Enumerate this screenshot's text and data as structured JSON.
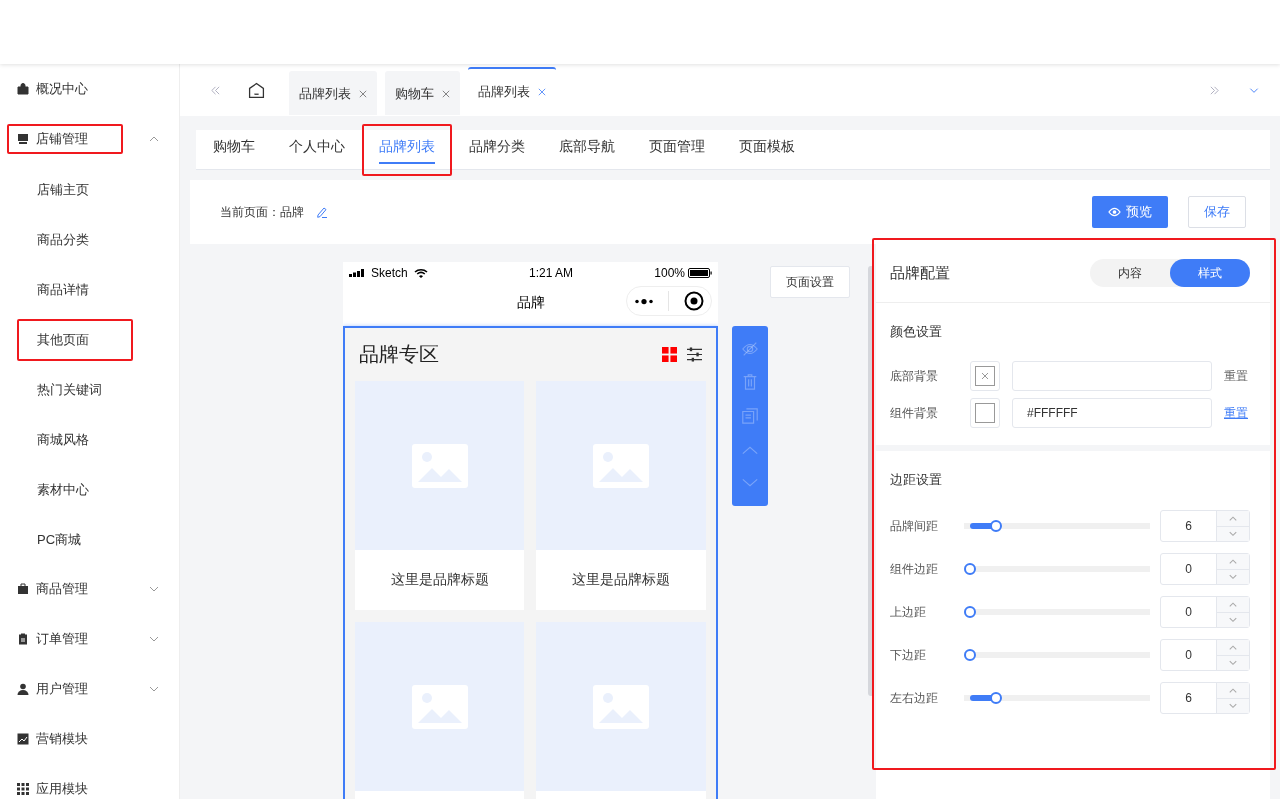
{
  "sidebar": {
    "items": [
      {
        "label": "概况中心",
        "highlighted": false
      },
      {
        "label": "店铺管理",
        "expanded": true,
        "highlighted": true,
        "children": [
          {
            "label": "店铺主页",
            "highlighted": false
          },
          {
            "label": "商品分类",
            "highlighted": false
          },
          {
            "label": "商品详情",
            "highlighted": false
          },
          {
            "label": "其他页面",
            "highlighted": true
          },
          {
            "label": "热门关键词",
            "highlighted": false
          },
          {
            "label": "商城风格",
            "highlighted": false
          },
          {
            "label": "素材中心",
            "highlighted": false
          },
          {
            "label": "PC商城",
            "highlighted": false
          }
        ]
      },
      {
        "label": "商品管理",
        "expanded": false,
        "highlighted": false
      },
      {
        "label": "订单管理",
        "expanded": false,
        "highlighted": false
      },
      {
        "label": "用户管理",
        "expanded": false,
        "highlighted": false
      },
      {
        "label": "营销模块",
        "highlighted": false
      },
      {
        "label": "应用模块",
        "highlighted": false
      }
    ]
  },
  "tabbar": {
    "tabs": [
      {
        "label": "品牌列表",
        "selected": false
      },
      {
        "label": "购物车",
        "selected": false
      },
      {
        "label": "品牌列表",
        "selected": true
      }
    ]
  },
  "subtabs": [
    {
      "label": "购物车",
      "selected": false,
      "highlighted": false
    },
    {
      "label": "个人中心",
      "selected": false,
      "highlighted": false
    },
    {
      "label": "品牌列表",
      "selected": true,
      "highlighted": true
    },
    {
      "label": "品牌分类",
      "selected": false,
      "highlighted": false
    },
    {
      "label": "底部导航",
      "selected": false,
      "highlighted": false
    },
    {
      "label": "页面管理",
      "selected": false,
      "highlighted": false
    },
    {
      "label": "页面模板",
      "selected": false,
      "highlighted": false
    }
  ],
  "page_bar": {
    "current_page": "当前页面：品牌",
    "preview_button": "预览",
    "save_button": "保存"
  },
  "page_settings_button": "页面设置",
  "phone": {
    "carrier": "Sketch",
    "time": "1:21 AM",
    "battery": "100%",
    "title": "品牌",
    "section_title": "品牌专区",
    "cards": [
      {
        "kind": "card",
        "title": "这里是品牌标题"
      },
      {
        "kind": "card",
        "title": "这里是品牌标题"
      },
      {
        "kind": "card"
      },
      {
        "kind": "card"
      }
    ]
  },
  "panel": {
    "title": "品牌配置",
    "highlighted": true,
    "segments": [
      {
        "label": "内容",
        "selected": false
      },
      {
        "label": "样式",
        "selected": true
      }
    ],
    "color_section": {
      "title": "颜色设置",
      "rows": [
        {
          "label": "底部背景",
          "reset": "重置",
          "disabled": true
        },
        {
          "label": "组件背景",
          "value": "#FFFFFF",
          "reset": "重置",
          "disabled": false
        }
      ]
    },
    "spacing_section": {
      "title": "边距设置",
      "rows": [
        {
          "label": "品牌间距",
          "level": 0.15,
          "value": "6"
        },
        {
          "label": "组件边距",
          "level": 0,
          "value": "0"
        },
        {
          "label": "上边距",
          "level": 0,
          "value": "0"
        },
        {
          "label": "下边距",
          "level": 0,
          "value": "0"
        },
        {
          "label": "左右边距",
          "level": 0.15,
          "value": "6"
        }
      ]
    }
  }
}
